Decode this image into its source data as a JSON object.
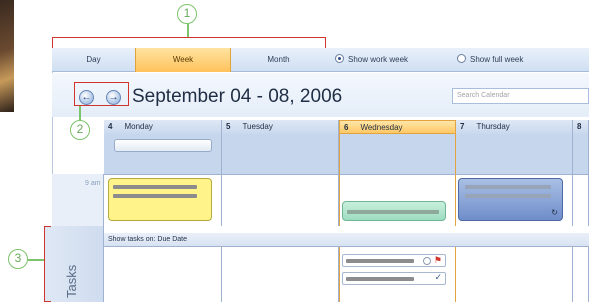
{
  "callouts": {
    "one": "1",
    "two": "2",
    "three": "3"
  },
  "view_tabs": {
    "day": "Day",
    "week": "Week",
    "month": "Month",
    "active": "week"
  },
  "week_options": {
    "show_work_week": "Show work week",
    "show_full_week": "Show full week",
    "selected": "show_work_week"
  },
  "nav": {
    "back_icon": "arrow-left-icon",
    "forward_icon": "arrow-right-icon",
    "date_range": "September 04 - 08, 2006"
  },
  "search": {
    "placeholder": "Search Calendar"
  },
  "days": [
    {
      "num": "4",
      "name": "Monday"
    },
    {
      "num": "5",
      "name": "Tuesday"
    },
    {
      "num": "6",
      "name": "Wednesday"
    },
    {
      "num": "7",
      "name": "Thursday"
    },
    {
      "num": "8",
      "name": ""
    }
  ],
  "today_index": 2,
  "time_slot": "9 am",
  "tasks": {
    "label": "Tasks",
    "header": "Show tasks on: Due Date"
  },
  "colors": {
    "accent_orange": "#ffc25c",
    "callout_green": "#7cc36b",
    "callout_red": "#d0342c",
    "appointment_yellow": "#fff38a",
    "appointment_green": "#9ddcc0",
    "appointment_blue": "#6f8dc9"
  }
}
